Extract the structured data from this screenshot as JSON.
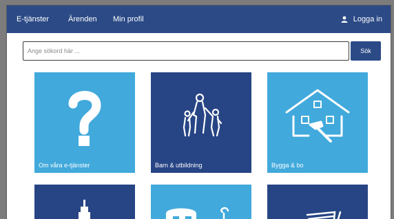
{
  "nav": {
    "items": [
      "E-tjänster",
      "Ärenden",
      "Min profil"
    ],
    "login_label": "Logga in"
  },
  "search": {
    "placeholder": "Ange sökord här ...",
    "button_label": "Sök"
  },
  "tiles": [
    {
      "label": "Om våra e-tjänster",
      "icon": "question-mark-icon",
      "color": "#41a9db"
    },
    {
      "label": "Barn & utbildning",
      "icon": "family-icon",
      "color": "#274585"
    },
    {
      "label": "Bygga & bo",
      "icon": "house-tools-icon",
      "color": "#41a9db"
    },
    {
      "label": "",
      "icon": "building-icon",
      "color": "#274585"
    },
    {
      "label": "",
      "icon": "people-icon",
      "color": "#41a9db"
    },
    {
      "label": "",
      "icon": "document-icon",
      "color": "#274585"
    }
  ],
  "colors": {
    "primary": "#2b4a86",
    "tile_light": "#41a9db",
    "tile_dark": "#274585"
  }
}
